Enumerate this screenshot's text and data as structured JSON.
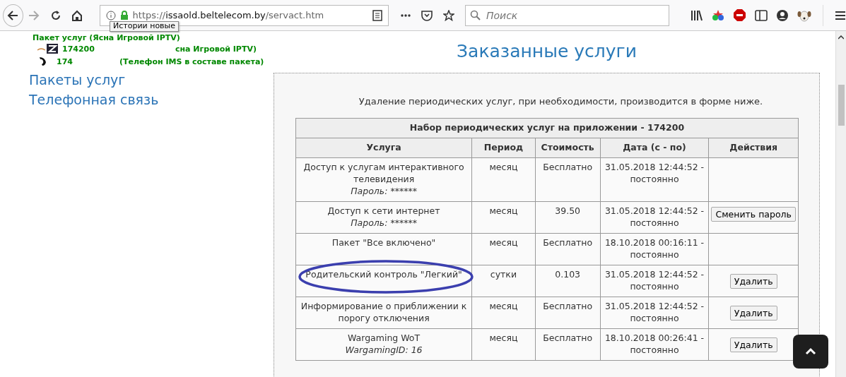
{
  "toolbar": {
    "url_prefix": "https://",
    "url_host": "issaold.beltelecom.by",
    "url_path": "/servact.htm",
    "tooltip": "Истории новые",
    "search": {
      "placeholder": "Поиск"
    }
  },
  "sidebar": {
    "package": "Пакет услуг (Ясна Игровой IPTV)",
    "accounts": [
      {
        "kind": "tv",
        "number": "174200",
        "description": "сна Игровой IPTV)"
      },
      {
        "kind": "phone",
        "number": "174",
        "description": "(Телефон IMS в составе пакета)"
      }
    ],
    "links": [
      "Пакеты услуг",
      "Телефонная связь"
    ]
  },
  "main": {
    "title": "Заказанные услуги",
    "notice": "Удаление периодических услуг, при необходимости, производится в форме ниже.",
    "table": {
      "caption": "Набор периодических услуг на приложении - 174200",
      "columns": [
        "Услуга",
        "Период",
        "Стоимость",
        "Дата (с - по)",
        "Действия"
      ],
      "rows": [
        {
          "service": "Доступ к услугам интерактивного телевидения",
          "note": "Пароль: ******",
          "period": "месяц",
          "cost": "Бесплатно",
          "date": "31.05.2018 12:44:52 - постоянно",
          "circled": false
        },
        {
          "service": "Доступ к сети интернет",
          "note": "Пароль: ******",
          "period": "месяц",
          "cost": "39.50",
          "date": "31.05.2018 12:44:52 - постоянно",
          "action": "Сменить пароль",
          "circled": false
        },
        {
          "service": "Пакет \"Все включено\"",
          "period": "месяц",
          "cost": "Бесплатно",
          "date": "18.10.2018 00:16:11 - постоянно",
          "circled": false
        },
        {
          "service": "Родительский контроль \"Легкий\"",
          "period": "сутки",
          "cost": "0.103",
          "date": "31.05.2018 12:44:52 - постоянно",
          "action": "Удалить",
          "circled": true
        },
        {
          "service": "Информирование о приближении к порогу отключения",
          "period": "месяц",
          "cost": "Бесплатно",
          "date": "31.05.2018 12:44:52 - постоянно",
          "action": "Удалить",
          "circled": false
        },
        {
          "service": "Wargaming WoT",
          "note": "WargamingID: 16",
          "period": "месяц",
          "cost": "Бесплатно",
          "date": "18.10.2018 00:26:41 - постоянно",
          "action": "Удалить",
          "circled": false
        }
      ]
    }
  }
}
